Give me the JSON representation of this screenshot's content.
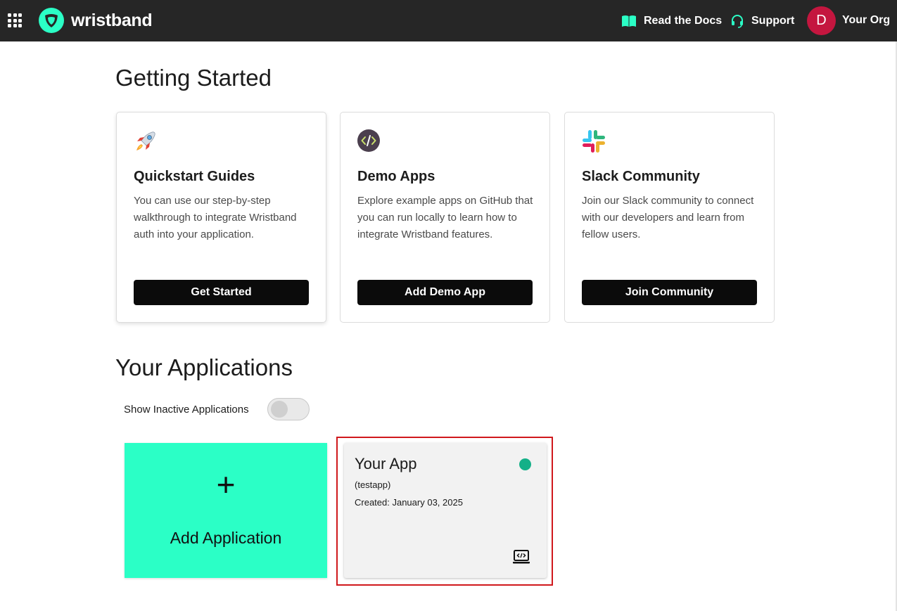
{
  "topbar": {
    "brand": "wristband",
    "docs_label": "Read the Docs",
    "support_label": "Support",
    "avatar_initial": "D",
    "org_name": "Your Org",
    "brand_color": "#2bffc6",
    "avatar_color": "#c4163f"
  },
  "getting_started": {
    "heading": "Getting Started",
    "cards": [
      {
        "icon": "rocket-icon",
        "title": "Quickstart Guides",
        "description": "You can use our step-by-step walkthrough to integrate Wristband auth into your application.",
        "button": "Get Started"
      },
      {
        "icon": "code-icon",
        "title": "Demo Apps",
        "description": "Explore example apps on GitHub that you can run locally to learn how to integrate Wristband features.",
        "button": "Add Demo App"
      },
      {
        "icon": "slack-icon",
        "title": "Slack Community",
        "description": "Join our Slack community to connect with our developers and learn from fellow users.",
        "button": "Join Community"
      }
    ]
  },
  "applications": {
    "heading": "Your Applications",
    "toggle_label": "Show Inactive Applications",
    "toggle_on": false,
    "add_plus": "+",
    "add_label": "Add Application",
    "apps": [
      {
        "name": "Your App",
        "slug": "(testapp)",
        "created": "Created: January 03, 2025",
        "status": "active",
        "status_color": "#14b088"
      }
    ]
  }
}
